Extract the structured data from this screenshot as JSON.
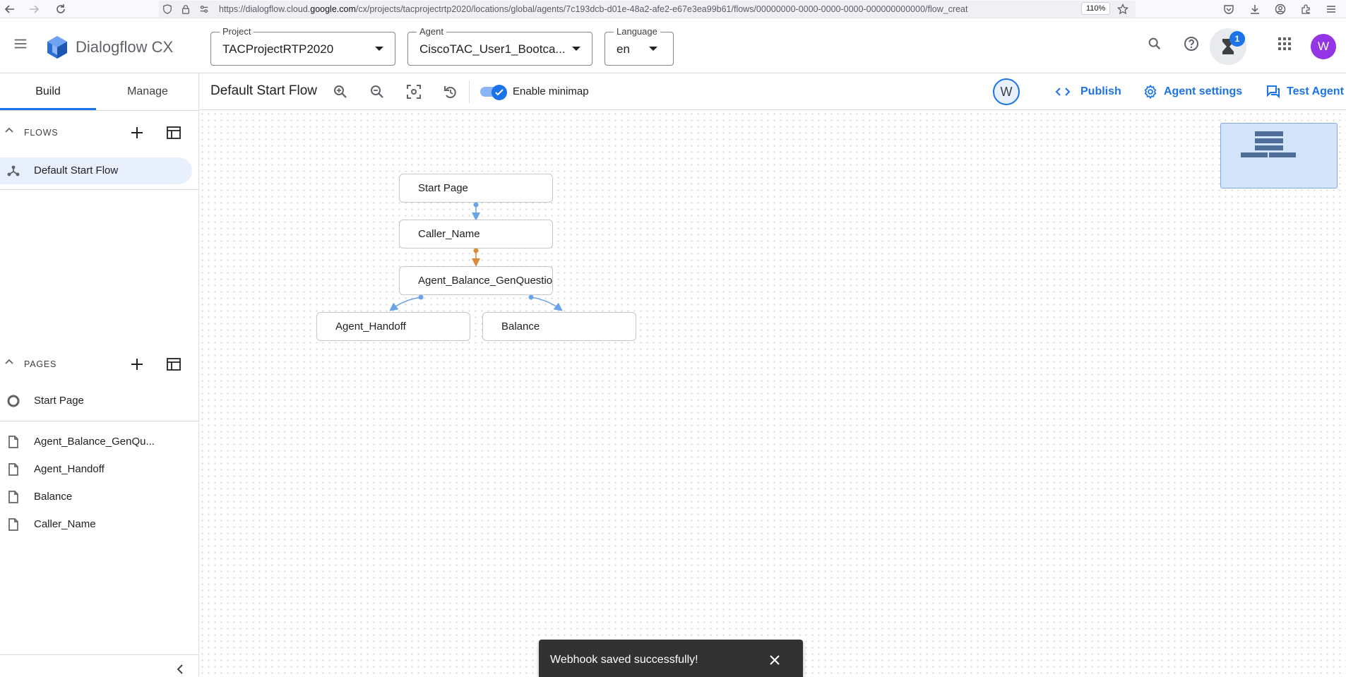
{
  "browser": {
    "url_prefix": "https://dialogflow.cloud.",
    "url_domain": "google.com",
    "url_suffix": "/cx/projects/tacprojectrtp2020/locations/global/agents/7c193dcb-d01e-48a2-afe2-e67e3ea99b61/flows/00000000-0000-0000-0000-000000000000/flow_creat",
    "zoom": "110%"
  },
  "header": {
    "app_name": "Dialogflow CX",
    "project": {
      "label": "Project",
      "value": "TACProjectRTP2020"
    },
    "agent": {
      "label": "Agent",
      "value": "CiscoTAC_User1_Bootca..."
    },
    "language": {
      "label": "Language",
      "value": "en"
    },
    "notification_count": "1",
    "avatar_letter": "W"
  },
  "sidebar": {
    "tabs": [
      {
        "label": "Build"
      },
      {
        "label": "Manage"
      }
    ],
    "flows": {
      "title": "FLOWS",
      "items": [
        {
          "label": "Default Start Flow"
        }
      ]
    },
    "pages": {
      "title": "PAGES",
      "start_page": "Start Page",
      "items": [
        {
          "label": "Agent_Balance_GenQu..."
        },
        {
          "label": "Agent_Handoff"
        },
        {
          "label": "Balance"
        },
        {
          "label": "Caller_Name"
        }
      ]
    }
  },
  "toolbar": {
    "flow_title": "Default Start Flow",
    "minimap_label": "Enable minimap",
    "minimap_enabled": true,
    "presence_letter": "W",
    "publish": "Publish",
    "agent_settings": "Agent settings",
    "test_agent": "Test Agent"
  },
  "canvas": {
    "nodes": [
      {
        "label": "Start Page"
      },
      {
        "label": "Caller_Name"
      },
      {
        "label": "Agent_Balance_GenQuestion"
      },
      {
        "label": "Agent_Handoff"
      },
      {
        "label": "Balance"
      }
    ]
  },
  "snackbar": {
    "message": "Webhook saved successfully!"
  },
  "colors": {
    "accent": "#1a73e8",
    "edge_blue": "#6aa3e8",
    "edge_orange": "#d98b3a",
    "avatar": "#9334e6",
    "badge": "#1a73e8"
  }
}
